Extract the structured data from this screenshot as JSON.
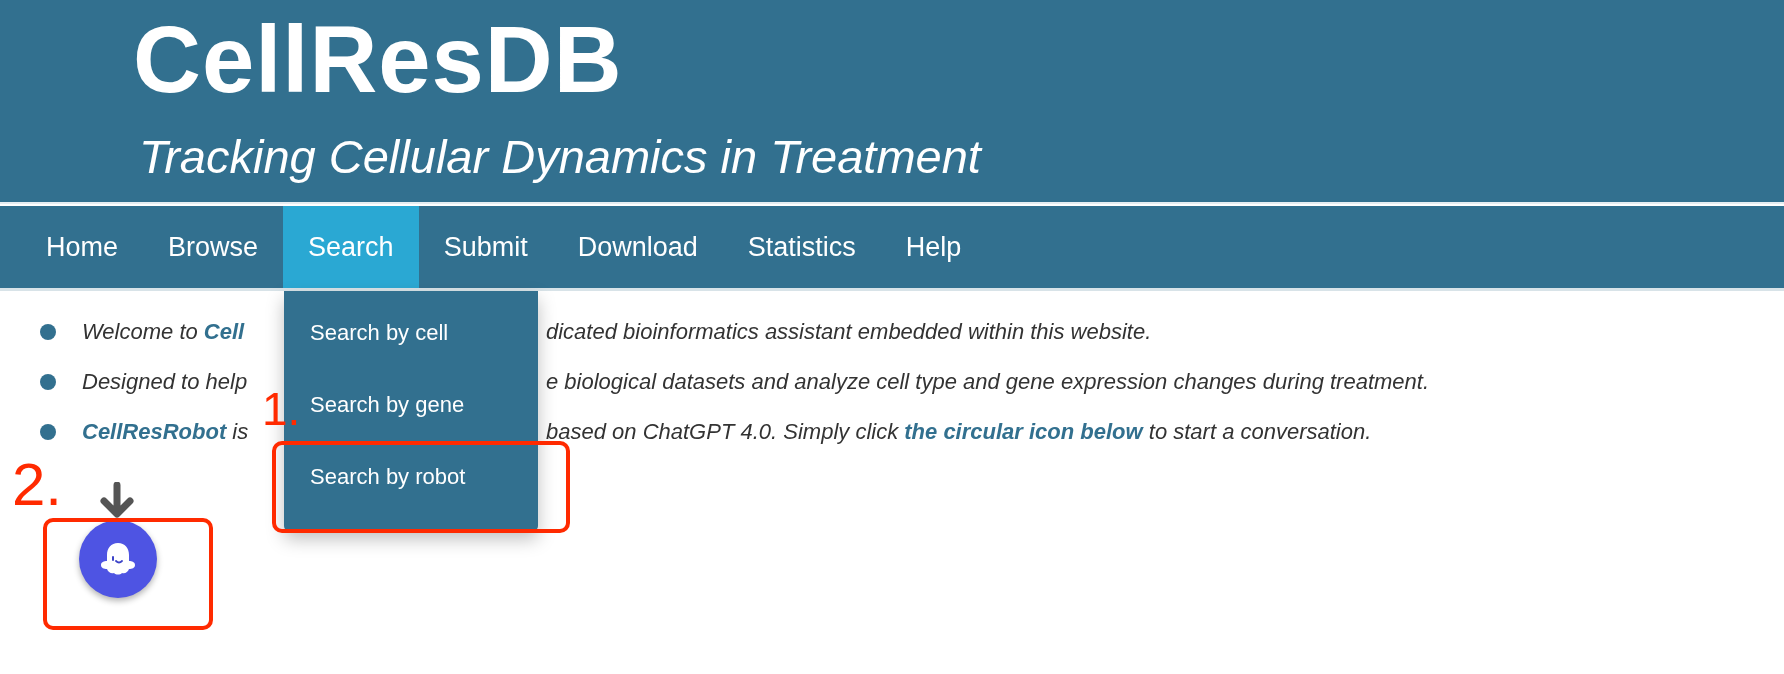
{
  "header": {
    "title": "CellResDB",
    "subtitle": "Tracking Cellular Dynamics in Treatment"
  },
  "nav": {
    "items": [
      {
        "label": "Home",
        "selected": false
      },
      {
        "label": "Browse",
        "selected": false
      },
      {
        "label": "Search",
        "selected": true,
        "expanded": true
      },
      {
        "label": "Submit",
        "selected": false
      },
      {
        "label": "Download",
        "selected": false
      },
      {
        "label": "Statistics",
        "selected": false
      },
      {
        "label": "Help",
        "selected": false
      }
    ]
  },
  "dropdown": {
    "items": [
      "Search by cell",
      "Search by gene",
      "Search by robot"
    ]
  },
  "intro": [
    {
      "left": "Welcome to **Cell**",
      "right": "dicated bioinformatics assistant embedded within this website."
    },
    {
      "left": "Designed to help",
      "right": "e biological datasets and analyze cell type and gene expression changes during treatment."
    },
    {
      "left": "**CellResRobot** is",
      "right": "based on ChatGPT 4.0. Simply click **the circular icon below** to start a conversation."
    }
  ],
  "annotations": [
    {
      "label": "1."
    },
    {
      "label": "2."
    }
  ]
}
